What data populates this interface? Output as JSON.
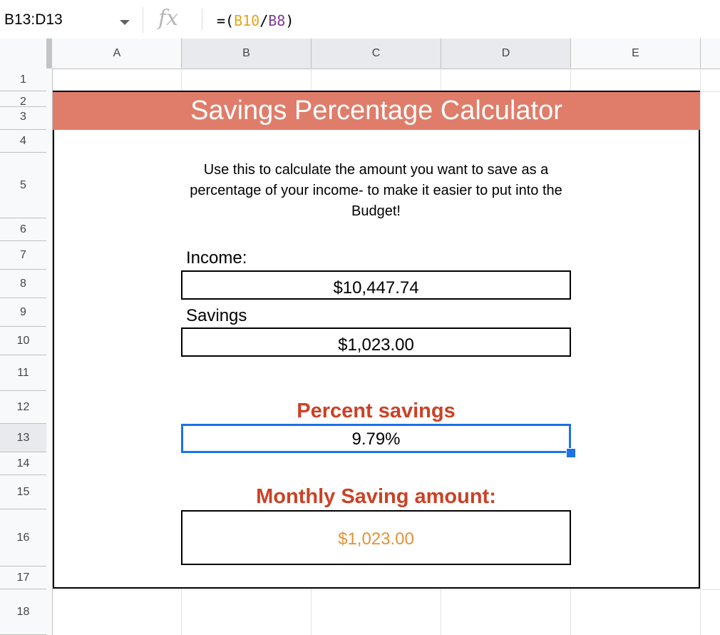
{
  "formula_bar": {
    "name_box": "B13:D13",
    "fx_symbol": "fx",
    "formula_prefix": "=(",
    "formula_ref1": "B10",
    "formula_sep": "/",
    "formula_ref2": "B8",
    "formula_suffix": ")"
  },
  "columns": [
    "A",
    "B",
    "C",
    "D",
    "E"
  ],
  "rows": [
    "1",
    "2",
    "3",
    "4",
    "5",
    "6",
    "7",
    "8",
    "9",
    "10",
    "11",
    "12",
    "13",
    "14",
    "15",
    "16",
    "17",
    "18"
  ],
  "sheet": {
    "title": "Savings Percentage Calculator",
    "description": "Use this to calculate the amount you want to save as a percentage of your income- to make it easier to put into the Budget!",
    "income_label": "Income:",
    "income_value": "$10,447.74",
    "savings_label": "Savings",
    "savings_value": "$1,023.00",
    "percent_label": "Percent savings",
    "percent_value": "9.79%",
    "monthly_label": "Monthly Saving amount:",
    "monthly_value": "$1,023.00"
  },
  "colors": {
    "title_band": "#df7d6a",
    "label_red": "#cc4125",
    "monthly_value": "#e69138",
    "selection": "#1a73e8"
  }
}
